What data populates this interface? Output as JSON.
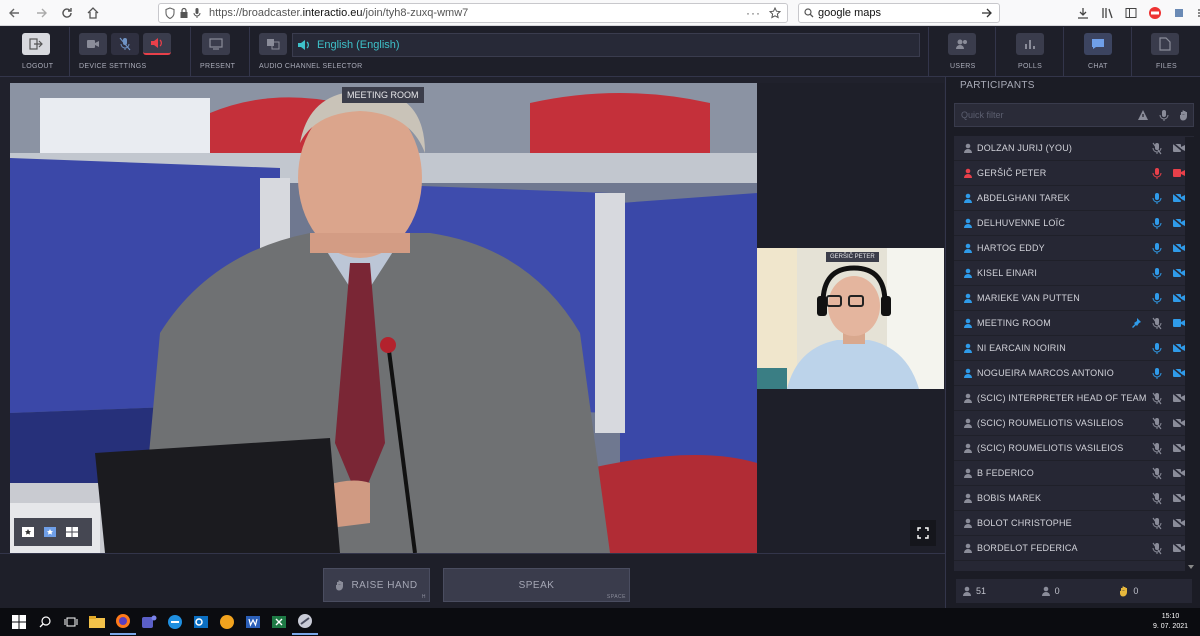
{
  "browser": {
    "url_prefix": "https://broadcaster.",
    "url_domain": "interactio.eu",
    "url_path": "/join/tyh8-zuxq-wmw7",
    "more": "···",
    "search_value": "google maps"
  },
  "toolbar": {
    "logout_label": "LOGOUT",
    "device_settings_label": "DEVICE SETTINGS",
    "present_label": "PRESENT",
    "audio_channel_label": "AUDIO CHANNEL SELECTOR",
    "audio_channel_value": "English (English)",
    "users_label": "USERS",
    "polls_label": "POLLS",
    "chat_label": "CHAT",
    "files_label": "FILES",
    "accent_color": "#3ec1c9"
  },
  "stage": {
    "main_label": "MEETING ROOM",
    "thumb_label": "GERŠIČ PETER"
  },
  "controls": {
    "raise_hand": "RAISE HAND",
    "raise_hand_key": "H",
    "speak": "SPEAK",
    "speak_key": "SPACE"
  },
  "participants": {
    "title": "PARTICIPANTS",
    "filter_placeholder": "Quick filter",
    "list": [
      {
        "name": "DOLZAN JURIJ (YOU)",
        "status": "gray"
      },
      {
        "name": "GERŠIČ PETER",
        "status": "red"
      },
      {
        "name": "ABDELGHANI TAREK",
        "status": "blue"
      },
      {
        "name": "DELHUVENNE LOÏC",
        "status": "blue"
      },
      {
        "name": "HARTOG EDDY",
        "status": "blue"
      },
      {
        "name": "KISEL EINARI",
        "status": "blue"
      },
      {
        "name": "MARIEKE VAN PUTTEN",
        "status": "blue"
      },
      {
        "name": "MEETING ROOM",
        "status": "room"
      },
      {
        "name": "NI EARCAIN NOIRIN",
        "status": "blue"
      },
      {
        "name": "NOGUEIRA MARCOS ANTONIO",
        "status": "blue"
      },
      {
        "name": "(SCIC) INTERPRETER HEAD OF TEAM",
        "status": "gray"
      },
      {
        "name": "(SCIC) ROUMELIOTIS VASILEIOS",
        "status": "gray"
      },
      {
        "name": "(SCIC) ROUMELIOTIS VASILEIOS",
        "status": "gray"
      },
      {
        "name": "B FEDERICO",
        "status": "gray"
      },
      {
        "name": "BOBIS MAREK",
        "status": "gray"
      },
      {
        "name": "BOLOT CHRISTOPHE",
        "status": "gray"
      },
      {
        "name": "BORDELOT FEDERICA",
        "status": "gray"
      }
    ],
    "count_users": "51",
    "count_speakers": "0",
    "count_hands": "0",
    "colors": {
      "blue": "#2f9be9",
      "red": "#e8404a",
      "gray": "#8a8c99"
    }
  },
  "taskbar": {
    "time": "15:10",
    "date": "9. 07. 2021"
  }
}
